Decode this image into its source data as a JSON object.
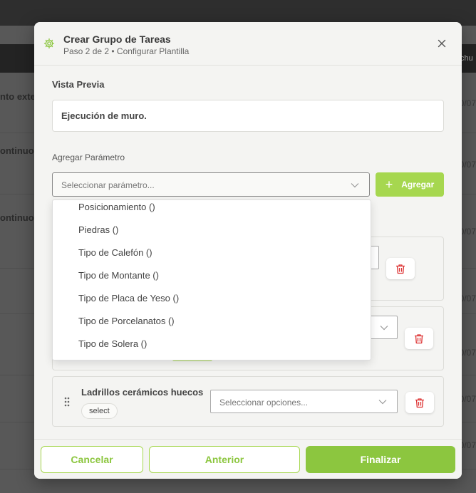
{
  "background": {
    "header_partial": "chu",
    "row_texts": [
      "nto exter",
      "ontinuo",
      "ontinuo"
    ],
    "dates": [
      "0/07",
      "0/07",
      "0/07",
      "0/07",
      "0/07",
      "0/07",
      "0/07",
      "0/07"
    ]
  },
  "modal": {
    "title": "Crear Grupo de Tareas",
    "subtitle": "Paso 2 de 2 • Configurar Plantilla",
    "preview_label": "Vista Previa",
    "preview_text": "Ejecución de muro.",
    "add_param_label": "Agregar Parámetro",
    "param_placeholder": "Seleccionar parámetro...",
    "add_button": "Agregar",
    "dropdown_options": [
      "Posicionamiento ()",
      "Piedras ()",
      "Tipo de Calefón ()",
      "Tipo de Montante ()",
      "Tipo de Placa de Yeso ()",
      "Tipo de Porcelanatos ()",
      "Tipo de Solera ()"
    ],
    "card3": {
      "name": "Ladrillos cerámicos huecos",
      "type": "select",
      "options_placeholder": "Seleccionar opciones..."
    },
    "footer": {
      "cancel": "Cancelar",
      "previous": "Anterior",
      "finish": "Finalizar"
    }
  },
  "colors": {
    "accent": "#8cc63f",
    "accent_light": "#a6d74f",
    "danger": "#dd3333"
  }
}
